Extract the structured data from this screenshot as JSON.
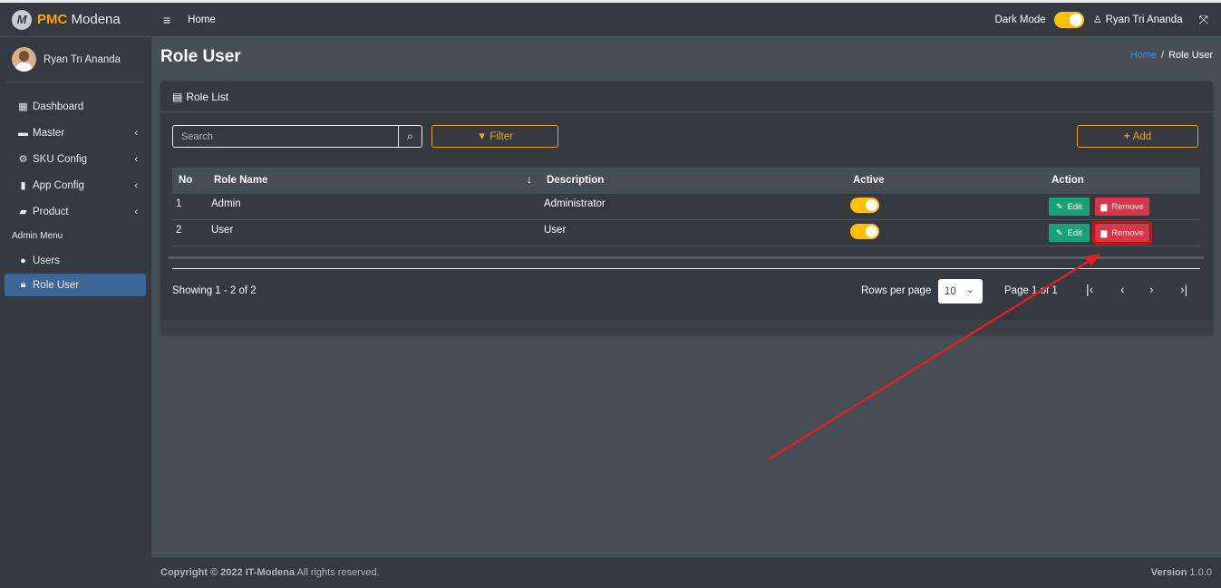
{
  "brand": {
    "logo_letter": "M",
    "name_bold": "PMC",
    "name_rest": "Modena"
  },
  "sidebar": {
    "user": "Ryan Tri Ananda",
    "items": [
      {
        "label": "Dashboard",
        "icon": "grid-icon"
      },
      {
        "label": "Master",
        "icon": "car-icon"
      },
      {
        "label": "SKU Config",
        "icon": "gear-icon"
      },
      {
        "label": "App Config",
        "icon": "mobile-icon"
      },
      {
        "label": "Product",
        "icon": "briefcase-icon"
      }
    ],
    "section_header": "Admin Menu",
    "admin_items": [
      {
        "label": "Users",
        "icon": "users-icon"
      },
      {
        "label": "Role User",
        "icon": "lock-icon"
      }
    ]
  },
  "topbar": {
    "home": "Home",
    "dark_mode_label": "Dark Mode",
    "user": "Ryan Tri Ananda"
  },
  "page": {
    "title": "Role User",
    "breadcrumb": [
      "Home",
      "Role User"
    ]
  },
  "card": {
    "title": "Role List",
    "search_placeholder": "Search",
    "filter_label": "Filter",
    "add_label": "Add",
    "columns": {
      "no": "No",
      "name": "Role Name",
      "desc": "Description",
      "active": "Active",
      "action": "Action"
    },
    "rows": [
      {
        "no": "1",
        "name": "Admin",
        "desc": "Administrator",
        "active": true
      },
      {
        "no": "2",
        "name": "User",
        "desc": "User",
        "active": true
      }
    ],
    "edit_label": "Edit",
    "remove_label": "Remove",
    "showing": "Showing 1 - 2 of 2",
    "rows_per_page_label": "Rows per page",
    "rows_per_page_value": "10",
    "page_info": "Page 1 of 1"
  },
  "footer": {
    "copyright_prefix": "Copyright © 2022",
    "company": "IT-Modena",
    "rights": "All rights reserved.",
    "version_label": "Version",
    "version": "1.0.0"
  },
  "colors": {
    "accent": "#f0a11d",
    "edit": "#17a277",
    "remove": "#dc3545",
    "toggle": "#ffc107",
    "active_nav": "#3c6796",
    "link": "#3f8cff"
  }
}
